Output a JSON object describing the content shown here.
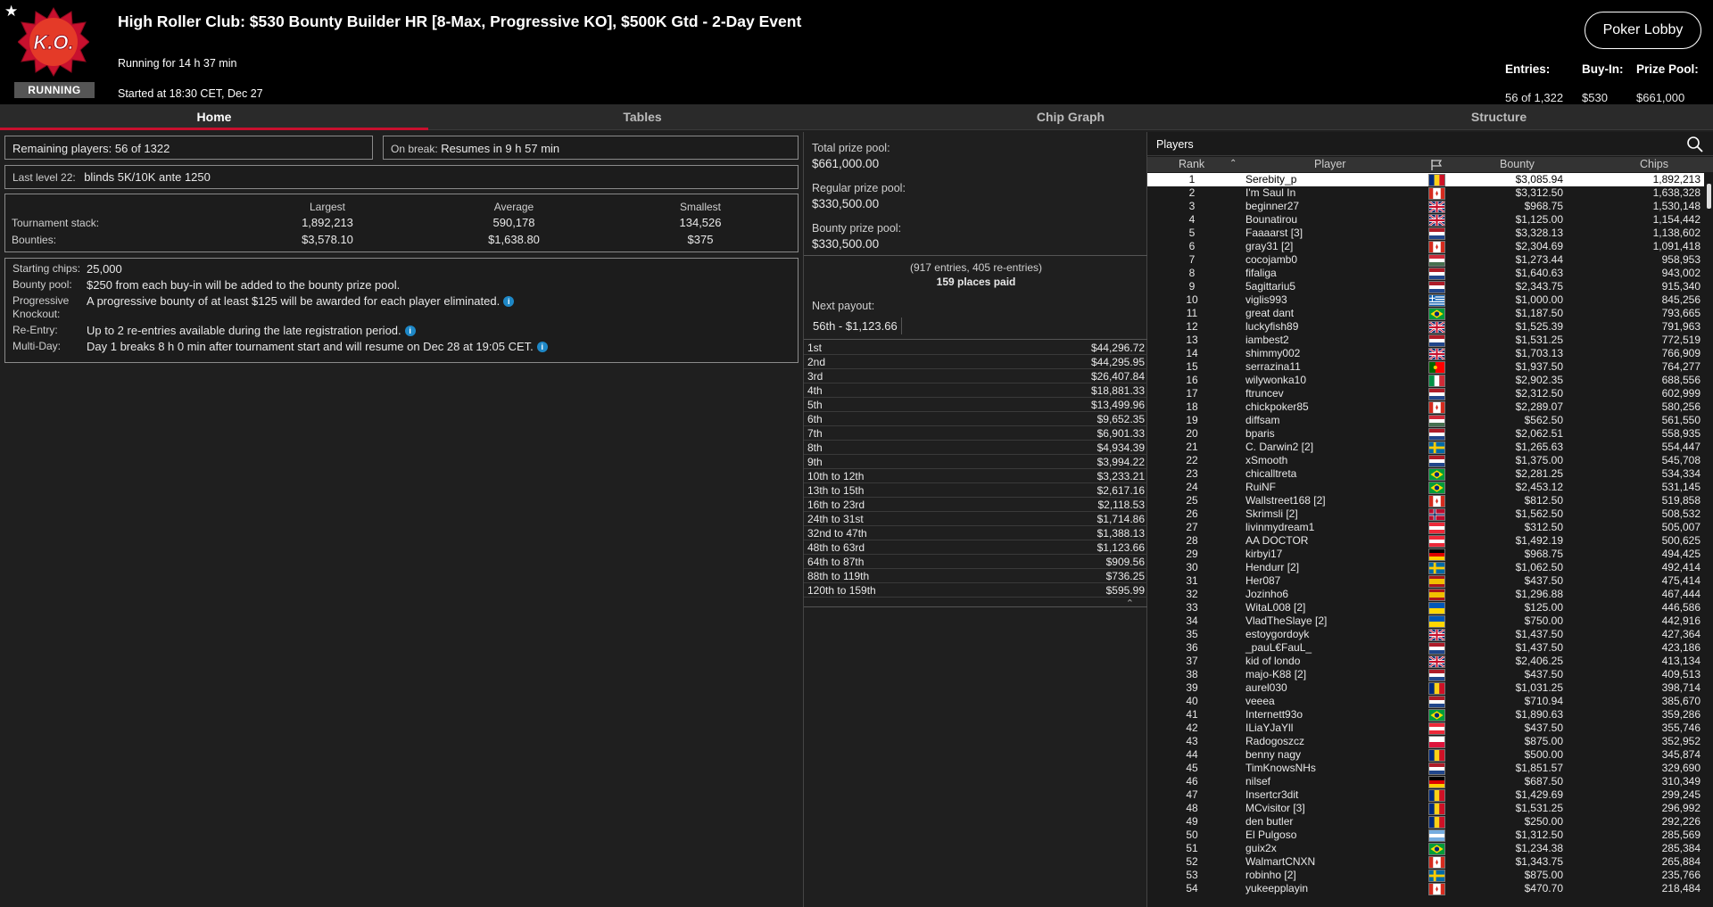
{
  "header": {
    "title": "High Roller Club: $530 Bounty Builder HR [8-Max, Progressive KO], $500K Gtd - 2-Day Event",
    "running_for": "Running for 14 h 37 min",
    "started": "Started at 18:30 CET, Dec 27",
    "status_badge": "RUNNING",
    "logo_text": "K.O.",
    "lobby_button": "Poker Lobby",
    "entries_label": "Entries:",
    "entries_value": "56 of 1,322",
    "buyin_label": "Buy-In:",
    "buyin_value": "$530",
    "prizepool_label": "Prize Pool:",
    "prizepool_value": "$661,000"
  },
  "tabs": [
    "Home",
    "Tables",
    "Chip Graph",
    "Structure"
  ],
  "home": {
    "remaining": "Remaining players: 56 of 1322",
    "onbreak_label": "On break:",
    "onbreak_value": "Resumes in 9 h 57 min",
    "lastlevel_label": "Last level 22:",
    "lastlevel_value": "blinds 5K/10K ante 1250",
    "stack_label": "Tournament stack:",
    "bounties_label": "Bounties:",
    "col_largest": "Largest",
    "col_average": "Average",
    "col_smallest": "Smallest",
    "stack_largest": "1,892,213",
    "stack_average": "590,178",
    "stack_smallest": "134,526",
    "bounty_largest": "$3,578.10",
    "bounty_average": "$1,638.80",
    "bounty_smallest": "$375",
    "info": [
      {
        "k": "Starting chips:",
        "v": "25,000",
        "i": false
      },
      {
        "k": "Bounty pool:",
        "v": "$250 from each buy-in will be added to the bounty prize pool.",
        "i": false
      },
      {
        "k": "Progressive Knockout:",
        "v": "A progressive bounty of at least $125 will be awarded for each player eliminated.",
        "i": true
      },
      {
        "k": "Re-Entry:",
        "v": "Up to 2 re-entries available during the late registration period.",
        "i": true
      },
      {
        "k": "Multi-Day:",
        "v": "Day 1 breaks 8 h 0 min after tournament start and will resume on Dec 28 at 19:05 CET.",
        "i": true
      }
    ]
  },
  "prize": {
    "total_label": "Total prize pool:",
    "total": "$661,000.00",
    "regular_label": "Regular prize pool:",
    "regular": "$330,500.00",
    "bounty_label": "Bounty prize pool:",
    "bounty": "$330,500.00",
    "entries_note": "(917 entries, 405 re-entries)",
    "places_paid": "159 places paid",
    "next_label": "Next payout:",
    "next_value": "56th - $1,123.66",
    "payouts": [
      [
        "1st",
        "$44,296.72"
      ],
      [
        "2nd",
        "$44,295.95"
      ],
      [
        "3rd",
        "$26,407.84"
      ],
      [
        "4th",
        "$18,881.33"
      ],
      [
        "5th",
        "$13,499.96"
      ],
      [
        "6th",
        "$9,652.35"
      ],
      [
        "7th",
        "$6,901.33"
      ],
      [
        "8th",
        "$4,934.39"
      ],
      [
        "9th",
        "$3,994.22"
      ],
      [
        "10th to 12th",
        "$3,233.21"
      ],
      [
        "13th to 15th",
        "$2,617.16"
      ],
      [
        "16th to 23rd",
        "$2,118.53"
      ],
      [
        "24th to 31st",
        "$1,714.86"
      ],
      [
        "32nd to 47th",
        "$1,388.13"
      ],
      [
        "48th to 63rd",
        "$1,123.66"
      ],
      [
        "64th to 87th",
        "$909.56"
      ],
      [
        "88th to 119th",
        "$736.25"
      ],
      [
        "120th to 159th",
        "$595.99"
      ]
    ]
  },
  "players": {
    "title": "Players",
    "col_rank": "Rank",
    "col_player": "Player",
    "col_bounty": "Bounty",
    "col_chips": "Chips",
    "rows": [
      [
        "1",
        "Serebity_p",
        "$3,085.94",
        "1,892,213",
        "ro"
      ],
      [
        "2",
        "I'm Saul In",
        "$3,312.50",
        "1,638,328",
        "ca"
      ],
      [
        "3",
        "beginner27",
        "$968.75",
        "1,530,148",
        "gb"
      ],
      [
        "4",
        "Bounatirou",
        "$1,125.00",
        "1,154,442",
        "gb"
      ],
      [
        "5",
        "Faaaarst [3]",
        "$3,328.13",
        "1,138,602",
        "nl"
      ],
      [
        "6",
        "gray31 [2]",
        "$2,304.69",
        "1,091,418",
        "ca"
      ],
      [
        "7",
        "cocojamb0",
        "$1,273.44",
        "958,953",
        "hu"
      ],
      [
        "8",
        "fifaliga",
        "$1,640.63",
        "943,002",
        "nl"
      ],
      [
        "9",
        "5agittariu5",
        "$2,343.75",
        "915,340",
        "nl"
      ],
      [
        "10",
        "viglis993",
        "$1,000.00",
        "845,256",
        "gr"
      ],
      [
        "11",
        "great dant",
        "$1,187.50",
        "793,665",
        "br"
      ],
      [
        "12",
        "luckyfish89",
        "$1,525.39",
        "791,963",
        "gb"
      ],
      [
        "13",
        "iambest2",
        "$1,531.25",
        "772,519",
        "nl"
      ],
      [
        "14",
        "shimmy002",
        "$1,703.13",
        "766,909",
        "gb"
      ],
      [
        "15",
        "serrazina11",
        "$1,937.50",
        "764,277",
        "pt"
      ],
      [
        "16",
        "wilywonka10",
        "$2,902.35",
        "688,556",
        "it"
      ],
      [
        "17",
        "ftruncev",
        "$2,312.50",
        "602,999",
        "nl"
      ],
      [
        "18",
        "chickpoker85",
        "$2,289.07",
        "580,256",
        "ca"
      ],
      [
        "19",
        "diffsam",
        "$562.50",
        "561,550",
        "hu"
      ],
      [
        "20",
        "bparis",
        "$2,062.51",
        "558,935",
        "nl"
      ],
      [
        "21",
        "C. Darwin2 [2]",
        "$1,265.63",
        "554,447",
        "se"
      ],
      [
        "22",
        "xSmooth",
        "$1,375.00",
        "545,708",
        "nl"
      ],
      [
        "23",
        "chicalltreta",
        "$2,281.25",
        "534,334",
        "br"
      ],
      [
        "24",
        "RuiNF",
        "$2,453.12",
        "531,145",
        "br"
      ],
      [
        "25",
        "Wallstreet168 [2]",
        "$812.50",
        "519,858",
        "ca"
      ],
      [
        "26",
        "Skrimsli [2]",
        "$1,562.50",
        "508,532",
        "no"
      ],
      [
        "27",
        "livinmydream1",
        "$312.50",
        "505,007",
        "at"
      ],
      [
        "28",
        "AA DOCTOR",
        "$1,492.19",
        "500,625",
        "at"
      ],
      [
        "29",
        "kirbyi17",
        "$968.75",
        "494,425",
        "de"
      ],
      [
        "30",
        "Hendurr [2]",
        "$1,062.50",
        "492,414",
        "se"
      ],
      [
        "31",
        "Her087",
        "$437.50",
        "475,414",
        "es"
      ],
      [
        "32",
        "Jozinho6",
        "$1,296.88",
        "467,444",
        "es"
      ],
      [
        "33",
        "WitaL008 [2]",
        "$125.00",
        "446,586",
        "ua"
      ],
      [
        "34",
        "VladTheSlaye [2]",
        "$750.00",
        "442,916",
        "ua"
      ],
      [
        "35",
        "estoygordoyk",
        "$1,437.50",
        "427,364",
        "gb"
      ],
      [
        "36",
        "_pauL€FauL_",
        "$1,437.50",
        "423,186",
        "nl"
      ],
      [
        "37",
        "kid of londo",
        "$2,406.25",
        "413,134",
        "gb"
      ],
      [
        "38",
        "majo-K88 [2]",
        "$437.50",
        "409,513",
        "nl"
      ],
      [
        "39",
        "aurel030",
        "$1,031.25",
        "398,714",
        "ro"
      ],
      [
        "40",
        "veeea",
        "$710.94",
        "385,670",
        "nl"
      ],
      [
        "41",
        "Internett93o",
        "$1,890.63",
        "359,286",
        "br"
      ],
      [
        "42",
        "ILiaYJaYll",
        "$437.50",
        "355,746",
        "at"
      ],
      [
        "43",
        "Radogoszcz",
        "$875.00",
        "352,952",
        "pl"
      ],
      [
        "44",
        "benny nagy",
        "$500.00",
        "345,874",
        "ro"
      ],
      [
        "45",
        "TimKnowsNHs",
        "$1,851.57",
        "329,690",
        "nl"
      ],
      [
        "46",
        "nilsef",
        "$687.50",
        "310,349",
        "de"
      ],
      [
        "47",
        "Insertcr3dit",
        "$1,429.69",
        "299,245",
        "ro"
      ],
      [
        "48",
        "MCvisitor [3]",
        "$1,531.25",
        "296,992",
        "ro"
      ],
      [
        "49",
        "den butler",
        "$250.00",
        "292,226",
        "ro"
      ],
      [
        "50",
        "El Pulgoso",
        "$1,312.50",
        "285,569",
        "ar"
      ],
      [
        "51",
        "guix2x",
        "$1,234.38",
        "285,384",
        "br"
      ],
      [
        "52",
        "WalmartCNXN",
        "$1,343.75",
        "265,884",
        "ca"
      ],
      [
        "53",
        "robinho [2]",
        "$875.00",
        "235,766",
        "se"
      ],
      [
        "54",
        "yukeepplayin",
        "$470.70",
        "218,484",
        "ca"
      ]
    ]
  }
}
